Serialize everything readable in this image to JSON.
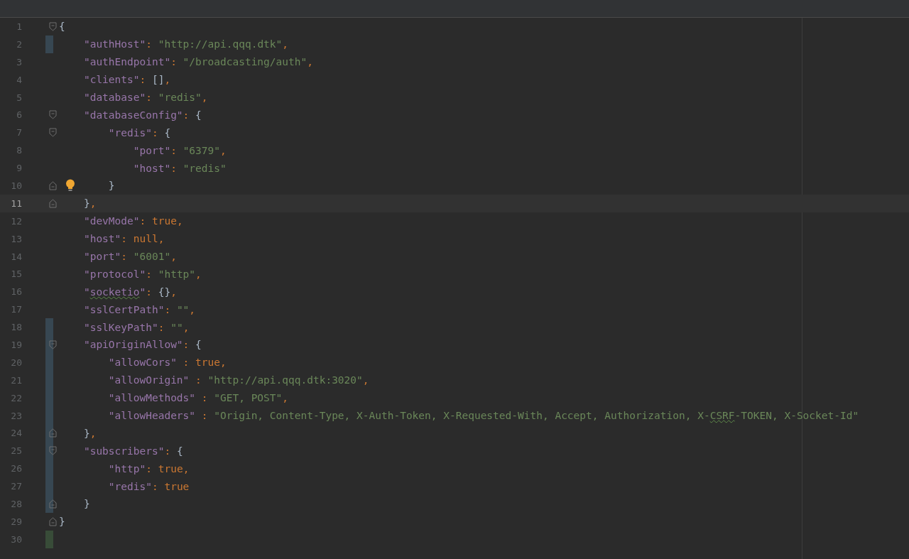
{
  "editor": {
    "lines": [
      {
        "number": "1",
        "current": false,
        "fold_start": true,
        "fold_end": false,
        "modified": false,
        "added": false,
        "bulb": false,
        "tokens": [
          {
            "kind": "brace",
            "text": "{"
          }
        ]
      },
      {
        "number": "2",
        "current": false,
        "fold_start": false,
        "fold_end": false,
        "modified": true,
        "added": false,
        "bulb": false,
        "tokens": [
          {
            "kind": "key",
            "text": "    \"authHost\""
          },
          {
            "kind": "punct",
            "text": ": "
          },
          {
            "kind": "string",
            "text": "\"http://api.qqq.dtk\""
          },
          {
            "kind": "punct",
            "text": ","
          }
        ]
      },
      {
        "number": "3",
        "current": false,
        "fold_start": false,
        "fold_end": false,
        "modified": false,
        "added": false,
        "bulb": false,
        "tokens": [
          {
            "kind": "key",
            "text": "    \"authEndpoint\""
          },
          {
            "kind": "punct",
            "text": ": "
          },
          {
            "kind": "string",
            "text": "\"/broadcasting/auth\""
          },
          {
            "kind": "punct",
            "text": ","
          }
        ]
      },
      {
        "number": "4",
        "current": false,
        "fold_start": false,
        "fold_end": false,
        "modified": false,
        "added": false,
        "bulb": false,
        "tokens": [
          {
            "kind": "key",
            "text": "    \"clients\""
          },
          {
            "kind": "punct",
            "text": ": "
          },
          {
            "kind": "brace",
            "text": "[]"
          },
          {
            "kind": "punct",
            "text": ","
          }
        ]
      },
      {
        "number": "5",
        "current": false,
        "fold_start": false,
        "fold_end": false,
        "modified": false,
        "added": false,
        "bulb": false,
        "tokens": [
          {
            "kind": "key",
            "text": "    \"database\""
          },
          {
            "kind": "punct",
            "text": ": "
          },
          {
            "kind": "string",
            "text": "\"redis\""
          },
          {
            "kind": "punct",
            "text": ","
          }
        ]
      },
      {
        "number": "6",
        "current": false,
        "fold_start": true,
        "fold_end": false,
        "modified": false,
        "added": false,
        "bulb": false,
        "tokens": [
          {
            "kind": "key",
            "text": "    \"databaseConfig\""
          },
          {
            "kind": "punct",
            "text": ": "
          },
          {
            "kind": "brace",
            "text": "{"
          }
        ]
      },
      {
        "number": "7",
        "current": false,
        "fold_start": true,
        "fold_end": false,
        "modified": false,
        "added": false,
        "bulb": false,
        "tokens": [
          {
            "kind": "key",
            "text": "        \"redis\""
          },
          {
            "kind": "punct",
            "text": ": "
          },
          {
            "kind": "brace",
            "text": "{"
          }
        ]
      },
      {
        "number": "8",
        "current": false,
        "fold_start": false,
        "fold_end": false,
        "modified": false,
        "added": false,
        "bulb": false,
        "tokens": [
          {
            "kind": "key",
            "text": "            \"port\""
          },
          {
            "kind": "punct",
            "text": ": "
          },
          {
            "kind": "string",
            "text": "\"6379\""
          },
          {
            "kind": "punct",
            "text": ","
          }
        ]
      },
      {
        "number": "9",
        "current": false,
        "fold_start": false,
        "fold_end": false,
        "modified": false,
        "added": false,
        "bulb": false,
        "tokens": [
          {
            "kind": "key",
            "text": "            \"host\""
          },
          {
            "kind": "punct",
            "text": ": "
          },
          {
            "kind": "string",
            "text": "\"redis\""
          }
        ]
      },
      {
        "number": "10",
        "current": false,
        "fold_start": false,
        "fold_end": true,
        "modified": false,
        "added": false,
        "bulb": true,
        "tokens": [
          {
            "kind": "brace",
            "text": "        }"
          }
        ]
      },
      {
        "number": "11",
        "current": true,
        "fold_start": false,
        "fold_end": true,
        "modified": false,
        "added": false,
        "bulb": false,
        "tokens": [
          {
            "kind": "brace",
            "text": "    }"
          },
          {
            "kind": "punct",
            "text": ","
          }
        ]
      },
      {
        "number": "12",
        "current": false,
        "fold_start": false,
        "fold_end": false,
        "modified": false,
        "added": false,
        "bulb": false,
        "tokens": [
          {
            "kind": "key",
            "text": "    \"devMode\""
          },
          {
            "kind": "punct",
            "text": ": "
          },
          {
            "kind": "keyword",
            "text": "true"
          },
          {
            "kind": "punct",
            "text": ","
          }
        ]
      },
      {
        "number": "13",
        "current": false,
        "fold_start": false,
        "fold_end": false,
        "modified": false,
        "added": false,
        "bulb": false,
        "tokens": [
          {
            "kind": "key",
            "text": "    \"host\""
          },
          {
            "kind": "punct",
            "text": ": "
          },
          {
            "kind": "keyword",
            "text": "null"
          },
          {
            "kind": "punct",
            "text": ","
          }
        ]
      },
      {
        "number": "14",
        "current": false,
        "fold_start": false,
        "fold_end": false,
        "modified": false,
        "added": false,
        "bulb": false,
        "tokens": [
          {
            "kind": "key",
            "text": "    \"port\""
          },
          {
            "kind": "punct",
            "text": ": "
          },
          {
            "kind": "string",
            "text": "\"6001\""
          },
          {
            "kind": "punct",
            "text": ","
          }
        ]
      },
      {
        "number": "15",
        "current": false,
        "fold_start": false,
        "fold_end": false,
        "modified": false,
        "added": false,
        "bulb": false,
        "tokens": [
          {
            "kind": "key",
            "text": "    \"protocol\""
          },
          {
            "kind": "punct",
            "text": ": "
          },
          {
            "kind": "string",
            "text": "\"http\""
          },
          {
            "kind": "punct",
            "text": ","
          }
        ]
      },
      {
        "number": "16",
        "current": false,
        "fold_start": false,
        "fold_end": false,
        "modified": false,
        "added": false,
        "bulb": false,
        "tokens": [
          {
            "kind": "key",
            "text": "    \""
          },
          {
            "kind": "key",
            "text": "socketio",
            "squiggle": true
          },
          {
            "kind": "key",
            "text": "\""
          },
          {
            "kind": "punct",
            "text": ": "
          },
          {
            "kind": "brace",
            "text": "{}"
          },
          {
            "kind": "punct",
            "text": ","
          }
        ]
      },
      {
        "number": "17",
        "current": false,
        "fold_start": false,
        "fold_end": false,
        "modified": false,
        "added": false,
        "bulb": false,
        "tokens": [
          {
            "kind": "key",
            "text": "    \"sslCertPath\""
          },
          {
            "kind": "punct",
            "text": ": "
          },
          {
            "kind": "string",
            "text": "\"\""
          },
          {
            "kind": "punct",
            "text": ","
          }
        ]
      },
      {
        "number": "18",
        "current": false,
        "fold_start": false,
        "fold_end": false,
        "modified": true,
        "added": false,
        "bulb": false,
        "tokens": [
          {
            "kind": "key",
            "text": "    \"sslKeyPath\""
          },
          {
            "kind": "punct",
            "text": ": "
          },
          {
            "kind": "string",
            "text": "\"\""
          },
          {
            "kind": "punct",
            "text": ","
          }
        ]
      },
      {
        "number": "19",
        "current": false,
        "fold_start": true,
        "fold_end": false,
        "modified": true,
        "added": false,
        "bulb": false,
        "tokens": [
          {
            "kind": "key",
            "text": "    \"apiOriginAllow\""
          },
          {
            "kind": "punct",
            "text": ": "
          },
          {
            "kind": "brace",
            "text": "{"
          }
        ]
      },
      {
        "number": "20",
        "current": false,
        "fold_start": false,
        "fold_end": false,
        "modified": true,
        "added": false,
        "bulb": false,
        "tokens": [
          {
            "kind": "key",
            "text": "        \"allowCors\""
          },
          {
            "kind": "punct",
            "text": " : "
          },
          {
            "kind": "keyword",
            "text": "true"
          },
          {
            "kind": "punct",
            "text": ","
          }
        ]
      },
      {
        "number": "21",
        "current": false,
        "fold_start": false,
        "fold_end": false,
        "modified": true,
        "added": false,
        "bulb": false,
        "tokens": [
          {
            "kind": "key",
            "text": "        \"allowOrigin\""
          },
          {
            "kind": "punct",
            "text": " : "
          },
          {
            "kind": "string",
            "text": "\"http://api.qqq.dtk:3020\""
          },
          {
            "kind": "punct",
            "text": ","
          }
        ]
      },
      {
        "number": "22",
        "current": false,
        "fold_start": false,
        "fold_end": false,
        "modified": true,
        "added": false,
        "bulb": false,
        "tokens": [
          {
            "kind": "key",
            "text": "        \"allowMethods\""
          },
          {
            "kind": "punct",
            "text": " : "
          },
          {
            "kind": "string",
            "text": "\"GET, POST\""
          },
          {
            "kind": "punct",
            "text": ","
          }
        ]
      },
      {
        "number": "23",
        "current": false,
        "fold_start": false,
        "fold_end": false,
        "modified": true,
        "added": false,
        "bulb": false,
        "tokens": [
          {
            "kind": "key",
            "text": "        \"allowHeaders\""
          },
          {
            "kind": "punct",
            "text": " : "
          },
          {
            "kind": "string",
            "text": "\"Origin, Content-Type, X-Auth-Token, X-Requested-With, Accept, Authorization, X-"
          },
          {
            "kind": "string",
            "text": "CSRF",
            "squiggle": true
          },
          {
            "kind": "string",
            "text": "-TOKEN, X-Socket-Id\""
          }
        ]
      },
      {
        "number": "24",
        "current": false,
        "fold_start": false,
        "fold_end": true,
        "modified": true,
        "added": false,
        "bulb": false,
        "tokens": [
          {
            "kind": "brace",
            "text": "    }"
          },
          {
            "kind": "punct",
            "text": ","
          }
        ]
      },
      {
        "number": "25",
        "current": false,
        "fold_start": true,
        "fold_end": false,
        "modified": true,
        "added": false,
        "bulb": false,
        "tokens": [
          {
            "kind": "key",
            "text": "    \"subscribers\""
          },
          {
            "kind": "punct",
            "text": ": "
          },
          {
            "kind": "brace",
            "text": "{"
          }
        ]
      },
      {
        "number": "26",
        "current": false,
        "fold_start": false,
        "fold_end": false,
        "modified": true,
        "added": false,
        "bulb": false,
        "tokens": [
          {
            "kind": "key",
            "text": "        \"http\""
          },
          {
            "kind": "punct",
            "text": ": "
          },
          {
            "kind": "keyword",
            "text": "true"
          },
          {
            "kind": "punct",
            "text": ","
          }
        ]
      },
      {
        "number": "27",
        "current": false,
        "fold_start": false,
        "fold_end": false,
        "modified": true,
        "added": false,
        "bulb": false,
        "tokens": [
          {
            "kind": "key",
            "text": "        \"redis\""
          },
          {
            "kind": "punct",
            "text": ": "
          },
          {
            "kind": "keyword",
            "text": "true"
          }
        ]
      },
      {
        "number": "28",
        "current": false,
        "fold_start": false,
        "fold_end": true,
        "modified": true,
        "added": false,
        "bulb": false,
        "tokens": [
          {
            "kind": "brace",
            "text": "    }"
          }
        ]
      },
      {
        "number": "29",
        "current": false,
        "fold_start": false,
        "fold_end": true,
        "modified": false,
        "added": false,
        "bulb": false,
        "tokens": [
          {
            "kind": "brace",
            "text": "}"
          }
        ]
      },
      {
        "number": "30",
        "current": false,
        "fold_start": false,
        "fold_end": false,
        "modified": false,
        "added": true,
        "bulb": false
      }
    ]
  }
}
